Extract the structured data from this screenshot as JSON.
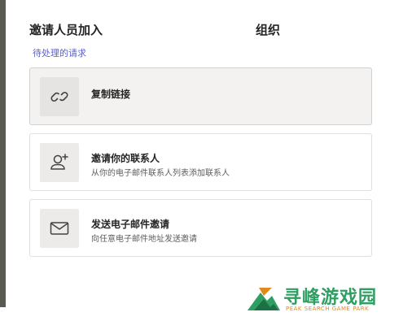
{
  "dialog": {
    "title": "邀请人员加入",
    "title_tail": "组织",
    "pending_requests_link": "待处理的请求"
  },
  "options": [
    {
      "label": "复制链接",
      "description": "",
      "icon": "link-icon"
    },
    {
      "label": "邀请你的联系人",
      "description": "从你的电子邮件联系人列表添加联系人",
      "icon": "add-person-icon"
    },
    {
      "label": "发送电子邮件邀请",
      "description": "向任意电子邮件地址发送邀请",
      "icon": "mail-icon"
    }
  ],
  "watermark": {
    "name": "寻峰游戏园",
    "subtitle": "PEAK SEARCH GAME PARK"
  },
  "colors": {
    "accent": "#5b5fc7",
    "left_bar": "#5b5a52",
    "selected_background": "#f3f2f1",
    "icon_tile": "#edebe9",
    "watermark_green": "#2f9e62",
    "watermark_orange": "#e08a1e"
  }
}
